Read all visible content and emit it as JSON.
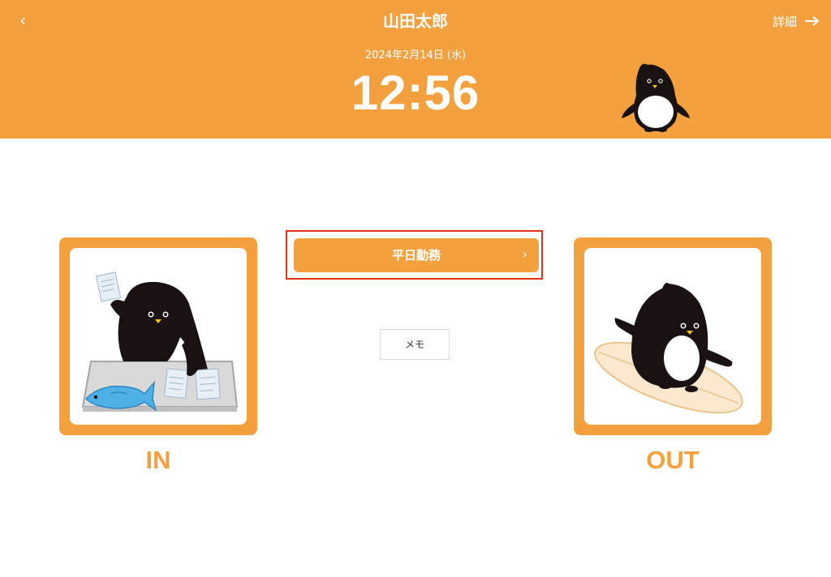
{
  "header": {
    "back_icon": "chevron-left-icon",
    "user_name": "山田太郎",
    "detail_label": "詳細",
    "detail_icon": "arrow-right-icon",
    "date": "2024年2月14日 (水)",
    "time": "12:56",
    "background_color": "#f3a03f"
  },
  "work_type": {
    "label": "平日勤務",
    "chevron": "›",
    "highlight_color": "#e8301e"
  },
  "memo": {
    "label": "メモ"
  },
  "punch": {
    "in_label": "IN",
    "out_label": "OUT"
  },
  "colors": {
    "accent": "#f3a03f",
    "text_on_accent": "#ffffff"
  }
}
